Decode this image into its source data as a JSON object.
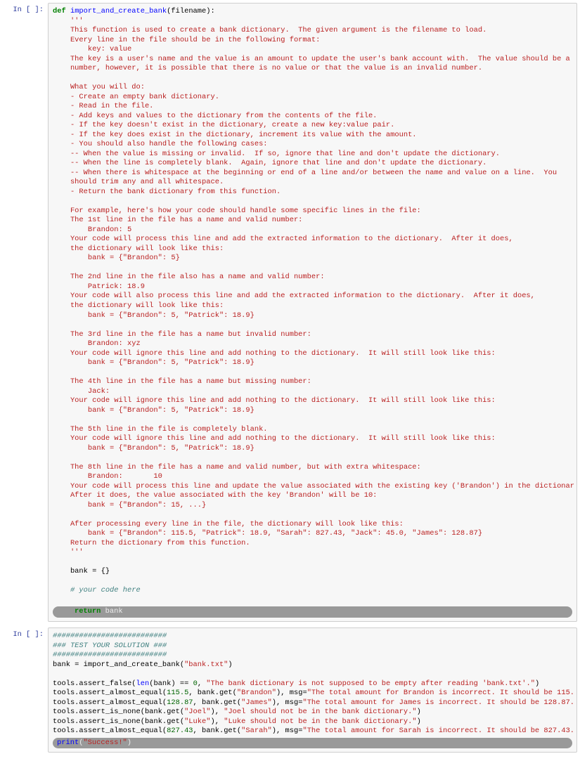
{
  "cells": [
    {
      "prompt": "In [ ]:",
      "tokens": [
        {
          "t": "def ",
          "c": "kw"
        },
        {
          "t": "import_and_create_bank",
          "c": "fn"
        },
        {
          "t": "(filename):\n"
        },
        {
          "t": "    '''\n",
          "c": "str"
        },
        {
          "t": "    This function is used to create a bank dictionary.  The given argument is the filename to load.\n",
          "c": "str"
        },
        {
          "t": "    Every line in the file should be in the following format:\n",
          "c": "str"
        },
        {
          "t": "        key: value\n",
          "c": "str"
        },
        {
          "t": "    The key is a user's name and the value is an amount to update the user's bank account with.  The value should be a\n",
          "c": "str"
        },
        {
          "t": "    number, however, it is possible that there is no value or that the value is an invalid number.\n\n",
          "c": "str"
        },
        {
          "t": "    What you will do:\n",
          "c": "str"
        },
        {
          "t": "    - Create an empty bank dictionary.\n",
          "c": "str"
        },
        {
          "t": "    - Read in the file.\n",
          "c": "str"
        },
        {
          "t": "    - Add keys and values to the dictionary from the contents of the file.\n",
          "c": "str"
        },
        {
          "t": "    - If the key doesn't exist in the dictionary, create a new key:value pair.\n",
          "c": "str"
        },
        {
          "t": "    - If the key does exist in the dictionary, increment its value with the amount.\n",
          "c": "str"
        },
        {
          "t": "    - You should also handle the following cases:\n",
          "c": "str"
        },
        {
          "t": "    -- When the value is missing or invalid.  If so, ignore that line and don't update the dictionary.\n",
          "c": "str"
        },
        {
          "t": "    -- When the line is completely blank.  Again, ignore that line and don't update the dictionary.\n",
          "c": "str"
        },
        {
          "t": "    -- When there is whitespace at the beginning or end of a line and/or between the name and value on a line.  You\n",
          "c": "str"
        },
        {
          "t": "    should trim any and all whitespace.\n",
          "c": "str"
        },
        {
          "t": "    - Return the bank dictionary from this function.\n\n",
          "c": "str"
        },
        {
          "t": "    For example, here's how your code should handle some specific lines in the file:\n",
          "c": "str"
        },
        {
          "t": "    The 1st line in the file has a name and valid number:\n",
          "c": "str"
        },
        {
          "t": "        Brandon: 5\n",
          "c": "str"
        },
        {
          "t": "    Your code will process this line and add the extracted information to the dictionary.  After it does,\n",
          "c": "str"
        },
        {
          "t": "    the dictionary will look like this:\n",
          "c": "str"
        },
        {
          "t": "        bank = {\"Brandon\": 5}\n\n",
          "c": "str"
        },
        {
          "t": "    The 2nd line in the file also has a name and valid number:\n",
          "c": "str"
        },
        {
          "t": "        Patrick: 18.9\n",
          "c": "str"
        },
        {
          "t": "    Your code will also process this line and add the extracted information to the dictionary.  After it does,\n",
          "c": "str"
        },
        {
          "t": "    the dictionary will look like this:\n",
          "c": "str"
        },
        {
          "t": "        bank = {\"Brandon\": 5, \"Patrick\": 18.9}\n\n",
          "c": "str"
        },
        {
          "t": "    The 3rd line in the file has a name but invalid number:\n",
          "c": "str"
        },
        {
          "t": "        Brandon: xyz\n",
          "c": "str"
        },
        {
          "t": "    Your code will ignore this line and add nothing to the dictionary.  It will still look like this:\n",
          "c": "str"
        },
        {
          "t": "        bank = {\"Brandon\": 5, \"Patrick\": 18.9}\n\n",
          "c": "str"
        },
        {
          "t": "    The 4th line in the file has a name but missing number:\n",
          "c": "str"
        },
        {
          "t": "        Jack:\n",
          "c": "str"
        },
        {
          "t": "    Your code will ignore this line and add nothing to the dictionary.  It will still look like this:\n",
          "c": "str"
        },
        {
          "t": "        bank = {\"Brandon\": 5, \"Patrick\": 18.9}\n\n",
          "c": "str"
        },
        {
          "t": "    The 5th line in the file is completely blank.\n",
          "c": "str"
        },
        {
          "t": "    Your code will ignore this line and add nothing to the dictionary.  It will still look like this:\n",
          "c": "str"
        },
        {
          "t": "        bank = {\"Brandon\": 5, \"Patrick\": 18.9}\n\n",
          "c": "str"
        },
        {
          "t": "    The 8th line in the file has a name and valid number, but with extra whitespace:\n",
          "c": "str"
        },
        {
          "t": "        Brandon:       10\n",
          "c": "str"
        },
        {
          "t": "    Your code will process this line and update the value associated with the existing key ('Brandon') in the dictionar\n",
          "c": "str"
        },
        {
          "t": "    After it does, the value associated with the key 'Brandon' will be 10:\n",
          "c": "str"
        },
        {
          "t": "        bank = {\"Brandon\": 15, ...}\n\n",
          "c": "str"
        },
        {
          "t": "    After processing every line in the file, the dictionary will look like this:\n",
          "c": "str"
        },
        {
          "t": "        bank = {\"Brandon\": 115.5, \"Patrick\": 18.9, \"Sarah\": 827.43, \"Jack\": 45.0, \"James\": 128.87}\n",
          "c": "str"
        },
        {
          "t": "    Return the dictionary from this function.\n",
          "c": "str"
        },
        {
          "t": "    '''\n\n",
          "c": "str"
        },
        {
          "t": "    bank = {}\n\n"
        },
        {
          "t": "    # your code here\n\n",
          "c": "cm"
        }
      ],
      "hl_tokens": [
        {
          "t": "    "
        },
        {
          "t": "return",
          "c": "kw"
        },
        {
          "t": " bank"
        }
      ]
    },
    {
      "prompt": "In [ ]:",
      "tokens": [
        {
          "t": "##########################\n",
          "c": "cm"
        },
        {
          "t": "### TEST YOUR SOLUTION ###\n",
          "c": "cm"
        },
        {
          "t": "##########################\n",
          "c": "cm"
        },
        {
          "t": "bank = import_and_create_bank("
        },
        {
          "t": "\"bank.txt\"",
          "c": "str"
        },
        {
          "t": ")\n\n"
        },
        {
          "t": "tools.assert_false("
        },
        {
          "t": "len",
          "c": "fn"
        },
        {
          "t": "(bank) == "
        },
        {
          "t": "0",
          "c": "num"
        },
        {
          "t": ", "
        },
        {
          "t": "\"The bank dictionary is not supposed to be empty after reading 'bank.txt'.\"",
          "c": "str"
        },
        {
          "t": ")\n"
        },
        {
          "t": "tools.assert_almost_equal("
        },
        {
          "t": "115.5",
          "c": "num"
        },
        {
          "t": ", bank.get("
        },
        {
          "t": "\"Brandon\"",
          "c": "str"
        },
        {
          "t": "), msg="
        },
        {
          "t": "\"The total amount for Brandon is incorrect. It should be 115.",
          "c": "str"
        },
        {
          "t": "\n"
        },
        {
          "t": "tools.assert_almost_equal("
        },
        {
          "t": "128.87",
          "c": "num"
        },
        {
          "t": ", bank.get("
        },
        {
          "t": "\"James\"",
          "c": "str"
        },
        {
          "t": "), msg="
        },
        {
          "t": "\"The total amount for James is incorrect. It should be 128.87.",
          "c": "str"
        },
        {
          "t": "\n"
        },
        {
          "t": "tools.assert_is_none(bank.get("
        },
        {
          "t": "\"Joel\"",
          "c": "str"
        },
        {
          "t": "), "
        },
        {
          "t": "\"Joel should not be in the bank dictionary.\"",
          "c": "str"
        },
        {
          "t": ")\n"
        },
        {
          "t": "tools.assert_is_none(bank.get("
        },
        {
          "t": "\"Luke\"",
          "c": "str"
        },
        {
          "t": "), "
        },
        {
          "t": "\"Luke should not be in the bank dictionary.\"",
          "c": "str"
        },
        {
          "t": ")\n"
        },
        {
          "t": "tools.assert_almost_equal("
        },
        {
          "t": "827.43",
          "c": "num"
        },
        {
          "t": ", bank.get("
        },
        {
          "t": "\"Sarah\"",
          "c": "str"
        },
        {
          "t": "), msg="
        },
        {
          "t": "\"The total amount for Sarah is incorrect. It should be 827.43.",
          "c": "str"
        },
        {
          "t": "\n"
        }
      ],
      "hl_tokens": [
        {
          "t": "print",
          "c": "fn"
        },
        {
          "t": "("
        },
        {
          "t": "\"Success!\"",
          "c": "str"
        },
        {
          "t": ")"
        }
      ]
    }
  ]
}
